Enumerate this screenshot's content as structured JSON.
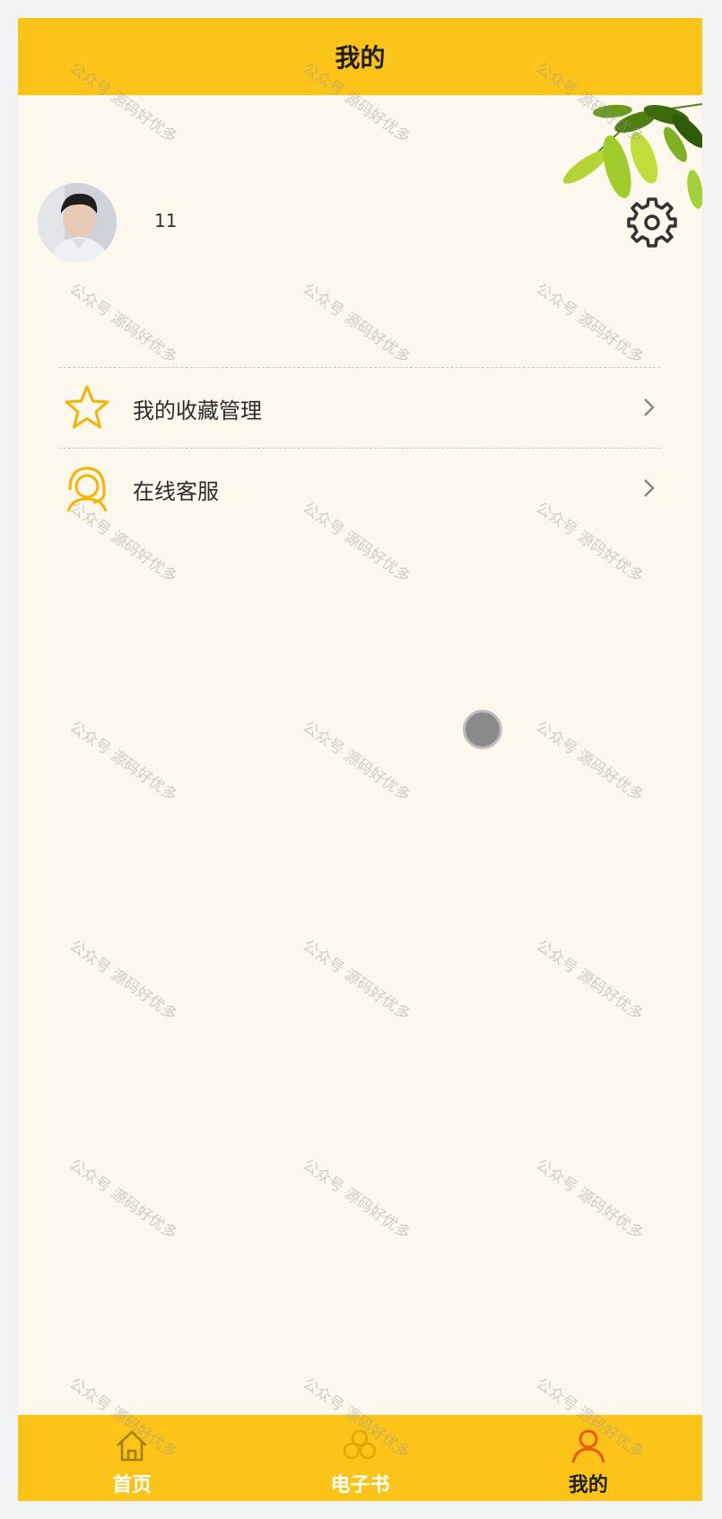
{
  "header": {
    "title": "我的"
  },
  "profile": {
    "username": "11"
  },
  "menu": {
    "items": [
      {
        "label": "我的收藏管理"
      },
      {
        "label": "在线客服"
      }
    ]
  },
  "tabbar": {
    "tabs": [
      {
        "label": "首页",
        "icon": "home-icon",
        "active": false
      },
      {
        "label": "电子书",
        "icon": "book-icon",
        "active": false
      },
      {
        "label": "我的",
        "icon": "user-icon",
        "active": true
      }
    ]
  },
  "watermark": {
    "text": "公众号 源码好优多"
  },
  "colors": {
    "primary": "#fcc419",
    "page_bg": "#fdf8ee",
    "icon_accent": "#f4b400",
    "active_icon": "#e8590c"
  }
}
